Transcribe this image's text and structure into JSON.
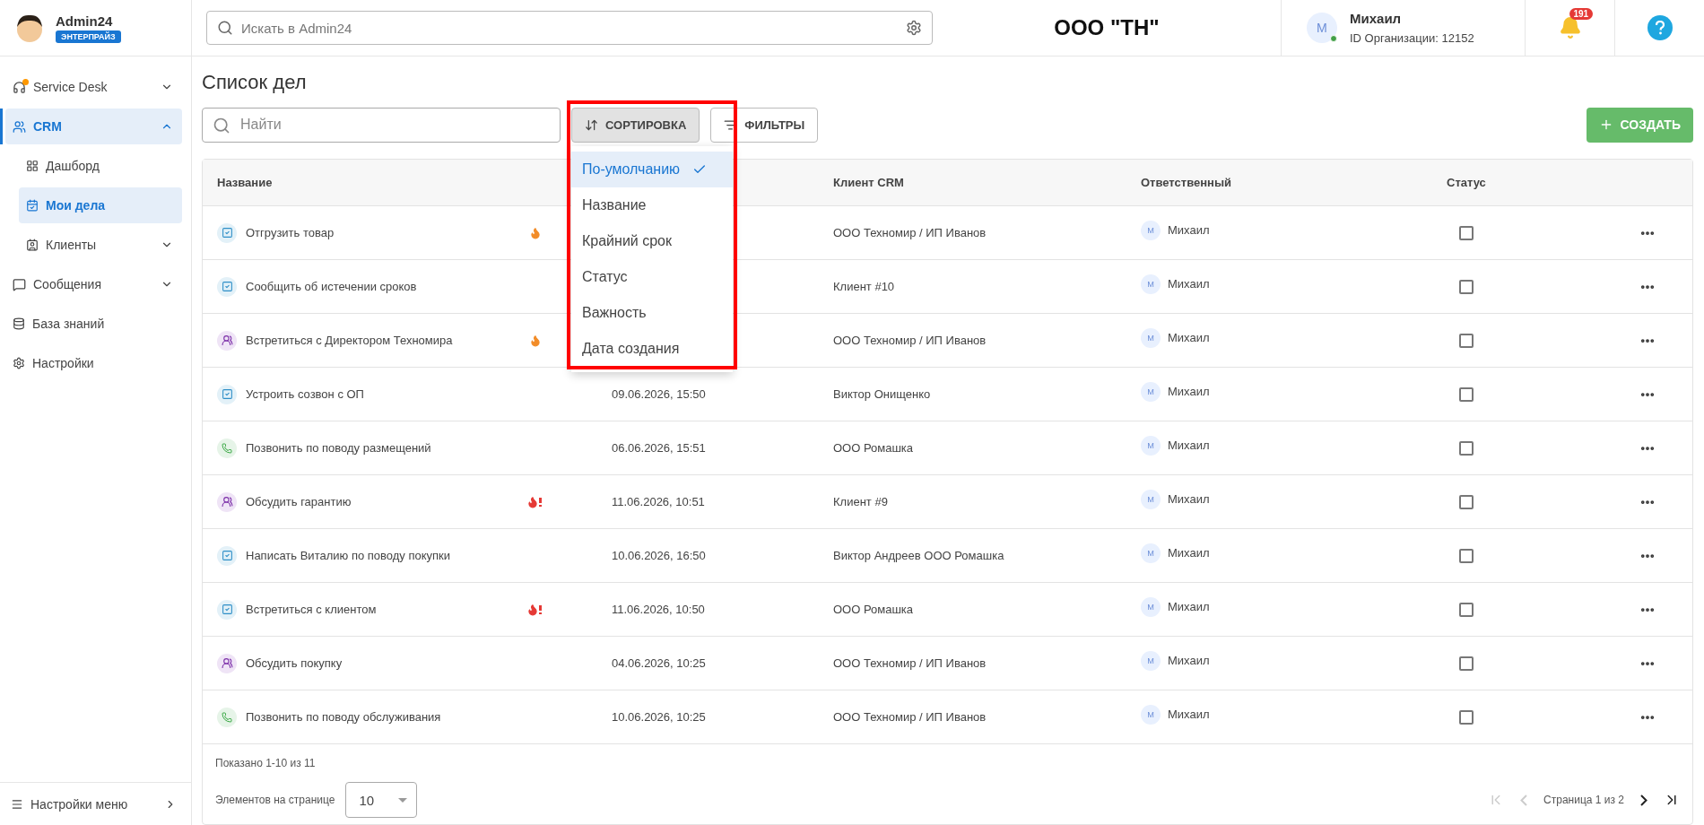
{
  "brand": {
    "name": "Admin24",
    "badge": "ЭНТЕРПРАЙЗ"
  },
  "sidebar": {
    "items": [
      {
        "label": "Service Desk",
        "expandable": true,
        "expanded": false,
        "selected": false
      },
      {
        "label": "CRM",
        "expandable": true,
        "expanded": true,
        "selected": true,
        "children": [
          {
            "label": "Дашборд",
            "expandable": false,
            "selected": false
          },
          {
            "label": "Мои дела",
            "expandable": false,
            "selected": true
          },
          {
            "label": "Клиенты",
            "expandable": true,
            "expanded": false,
            "selected": false
          }
        ]
      },
      {
        "label": "Сообщения",
        "expandable": true,
        "expanded": false,
        "selected": false
      },
      {
        "label": "База знаний",
        "expandable": false,
        "selected": false
      },
      {
        "label": "Настройки",
        "expandable": false,
        "selected": false
      }
    ],
    "footer": "Настройки меню"
  },
  "header": {
    "search": {
      "placeholder": "Искать в Admin24"
    },
    "organization": "ООО \"ТН\"",
    "user": {
      "initial": "М",
      "name": "Михаил",
      "org_id": "ID Организации: 12152",
      "online": true
    },
    "notifications": "191"
  },
  "page": {
    "title": "Список дел",
    "search": {
      "placeholder": "Найти"
    },
    "sort_button": "СОРТИРОВКА",
    "filter_button": "ФИЛЬТРЫ",
    "create_button": "СОЗДАТЬ",
    "sort_menu": {
      "open": true,
      "options": [
        {
          "label": "По-умолчанию",
          "selected": true
        },
        {
          "label": "Название",
          "selected": false
        },
        {
          "label": "Крайний срок",
          "selected": false
        },
        {
          "label": "Статус",
          "selected": false
        },
        {
          "label": "Важность",
          "selected": false
        },
        {
          "label": "Дата создания",
          "selected": false
        }
      ]
    }
  },
  "table": {
    "columns": {
      "name": "Название",
      "client": "Клиент CRM",
      "assignee": "Ответственный",
      "status": "Статус"
    },
    "rows": [
      {
        "kind": "task",
        "title": "Отгрузить товар",
        "hot": true,
        "urgent": false,
        "client": "ООО Техномир / ИП Иванов",
        "assignee_initial": "М",
        "assignee": "Михаил",
        "done": false
      },
      {
        "kind": "task",
        "title": "Сообщить об истечении сроков",
        "hot": false,
        "client": "Клиент #10",
        "assignee_initial": "М",
        "assignee": "Михаил",
        "done": false
      },
      {
        "kind": "meeting",
        "title": "Встретиться с Директором Техномира",
        "hot": true,
        "urgent": false,
        "client": "ООО Техномир / ИП Иванов",
        "assignee_initial": "М",
        "assignee": "Михаил",
        "done": false
      },
      {
        "kind": "task",
        "title": "Устроить созвон с ОП",
        "hot": false,
        "date": "09.06.2026, 15:50",
        "client": "Виктор Онищенко",
        "assignee_initial": "М",
        "assignee": "Михаил",
        "done": false
      },
      {
        "kind": "call",
        "title": "Позвонить по поводу размещений",
        "hot": false,
        "date": "06.06.2026, 15:51",
        "client": "ООО Ромашка",
        "assignee_initial": "М",
        "assignee": "Михаил",
        "done": false
      },
      {
        "kind": "meeting",
        "title": "Обсудить гарантию",
        "hot": true,
        "urgent": true,
        "date": "11.06.2026, 10:51",
        "client": "Клиент #9",
        "assignee_initial": "М",
        "assignee": "Михаил",
        "done": false
      },
      {
        "kind": "task",
        "title": "Написать Виталию по поводу покупки",
        "hot": false,
        "date": "10.06.2026, 16:50",
        "client": "Виктор Андреев ООО Ромашка",
        "assignee_initial": "М",
        "assignee": "Михаил",
        "done": false
      },
      {
        "kind": "task",
        "title": "Встретиться с клиентом",
        "hot": true,
        "urgent": true,
        "date": "11.06.2026, 10:50",
        "client": "ООО Ромашка",
        "assignee_initial": "М",
        "assignee": "Михаил",
        "done": false
      },
      {
        "kind": "meeting",
        "title": "Обсудить покупку",
        "hot": false,
        "date": "04.06.2026, 10:25",
        "client": "ООО Техномир / ИП Иванов",
        "assignee_initial": "М",
        "assignee": "Михаил",
        "done": false
      },
      {
        "kind": "call",
        "title": "Позвонить по поводу обслуживания",
        "hot": false,
        "date": "10.06.2026, 10:25",
        "client": "ООО Техномир / ИП Иванов",
        "assignee_initial": "М",
        "assignee": "Михаил",
        "done": false
      }
    ]
  },
  "footer": {
    "shown": "Показано 1-10 из 11",
    "per_page_label": "Элементов на странице",
    "per_page": "10",
    "page_label": "Страница 1 из 2"
  }
}
